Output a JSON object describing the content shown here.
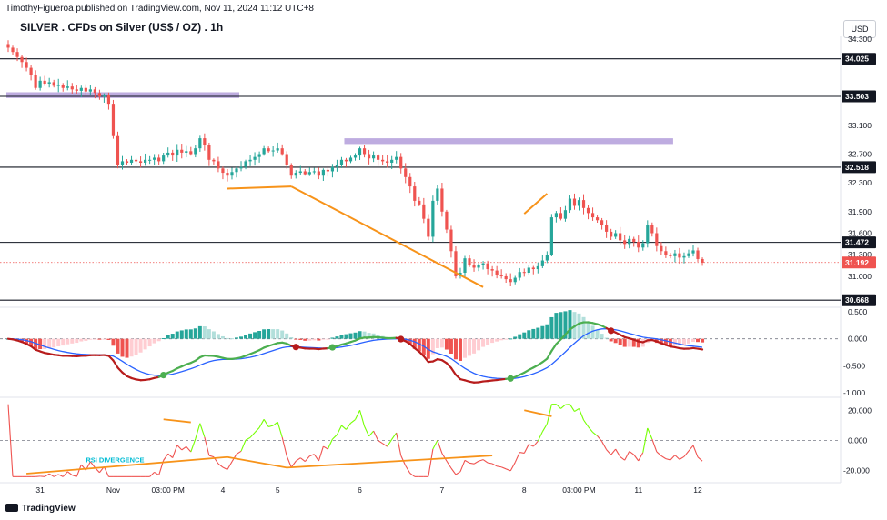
{
  "header": {
    "publisher": "TimothyFigueroa published on TradingView.com, Nov 11, 2024 11:12 UTC+8",
    "title": "SILVER . CFDs on Silver (US$ / OZ) . 1h",
    "currency_button": "USD",
    "brand": "TradingView"
  },
  "colors": {
    "up": "#26a69a",
    "down": "#ef5350",
    "zone": "#b39ddb",
    "trend": "#f7931a",
    "macd_line": "#2962ff",
    "macd_fast_up": "#4caf50",
    "macd_fast_down": "#b71c1c",
    "rsi_up": "#76ff03",
    "rsi_down": "#ef5350"
  },
  "chart_data": [
    {
      "type": "candlestick",
      "name": "price",
      "x_labels": [
        "31",
        "Nov",
        "03:00 PM",
        "4",
        "5",
        "6",
        "7",
        "8",
        "03:00 PM",
        "11",
        "12"
      ],
      "x_label_index": [
        7,
        23,
        35,
        47,
        59,
        77,
        95,
        113,
        125,
        138,
        151
      ],
      "y_ticks": [
        34.3,
        33.1,
        32.7,
        32.3,
        31.9,
        31.6,
        31.3,
        31.0
      ],
      "ylim": [
        30.62,
        34.35
      ],
      "horizontal_levels": [
        34.025,
        33.503,
        32.518,
        31.472,
        30.668
      ],
      "current_price": 31.192,
      "zones": [
        {
          "from_index": 0,
          "to_index": 51,
          "low": 33.48,
          "high": 33.56
        },
        {
          "from_index": 74,
          "to_index": 146,
          "low": 32.84,
          "high": 32.92
        }
      ],
      "trendlines": [
        {
          "x1": 48,
          "y1": 32.22,
          "x2": 62,
          "y2": 32.25
        },
        {
          "x1": 62,
          "y1": 32.25,
          "x2": 104,
          "y2": 30.85
        },
        {
          "x1": 113,
          "y1": 31.87,
          "x2": 118,
          "y2": 32.15
        }
      ],
      "closes": [
        34.18,
        34.12,
        34.05,
        33.98,
        33.9,
        33.8,
        33.62,
        33.72,
        33.68,
        33.7,
        33.65,
        33.66,
        33.62,
        33.64,
        33.6,
        33.58,
        33.62,
        33.57,
        33.6,
        33.55,
        33.5,
        33.52,
        33.4,
        32.95,
        32.55,
        32.6,
        32.58,
        32.62,
        32.6,
        32.58,
        32.62,
        32.62,
        32.65,
        32.6,
        32.68,
        32.72,
        32.68,
        32.76,
        32.72,
        32.74,
        32.7,
        32.78,
        32.92,
        32.82,
        32.62,
        32.6,
        32.5,
        32.44,
        32.4,
        32.45,
        32.5,
        32.52,
        32.6,
        32.62,
        32.66,
        32.7,
        32.78,
        32.74,
        32.75,
        32.78,
        32.7,
        32.55,
        32.4,
        32.44,
        32.46,
        32.42,
        32.45,
        32.46,
        32.4,
        32.48,
        32.46,
        32.52,
        32.55,
        32.62,
        32.6,
        32.65,
        32.68,
        32.78,
        32.7,
        32.64,
        32.68,
        32.62,
        32.6,
        32.58,
        32.62,
        32.66,
        32.5,
        32.38,
        32.25,
        32.05,
        32.0,
        31.8,
        31.55,
        32.05,
        32.22,
        31.9,
        31.65,
        31.35,
        31.0,
        31.05,
        31.25,
        31.15,
        31.12,
        31.16,
        31.18,
        31.1,
        31.08,
        31.02,
        31.0,
        30.96,
        30.92,
        30.98,
        31.06,
        31.05,
        31.12,
        31.1,
        31.14,
        31.22,
        31.3,
        31.82,
        31.88,
        31.8,
        31.92,
        32.08,
        31.98,
        32.06,
        31.95,
        31.88,
        31.82,
        31.78,
        31.72,
        31.62,
        31.55,
        31.6,
        31.5,
        31.45,
        31.52,
        31.48,
        31.4,
        31.46,
        31.72,
        31.6,
        31.42,
        31.35,
        31.3,
        31.28,
        31.32,
        31.26,
        31.28,
        31.32,
        31.36,
        31.24,
        31.19
      ]
    },
    {
      "type": "line",
      "name": "MACD",
      "y_ticks": [
        0.5,
        0.0,
        -0.5,
        -1.0
      ],
      "ylim": [
        -1.0,
        0.5
      ]
    },
    {
      "type": "line",
      "name": "RSI",
      "y_ticks": [
        20.0,
        0.0,
        -20.0
      ],
      "ylim": [
        -25,
        25
      ],
      "annotation": "RSI DIVERGENCE",
      "trendlines": [
        {
          "x1": 34,
          "y1": 14,
          "x2": 40,
          "y2": 12
        },
        {
          "x1": 4,
          "y1": -22,
          "x2": 48,
          "y2": -11
        },
        {
          "x1": 48,
          "y1": -11,
          "x2": 61,
          "y2": -18
        },
        {
          "x1": 61,
          "y1": -18,
          "x2": 106,
          "y2": -10
        },
        {
          "x1": 113,
          "y1": 20,
          "x2": 119,
          "y2": 16
        }
      ]
    }
  ]
}
